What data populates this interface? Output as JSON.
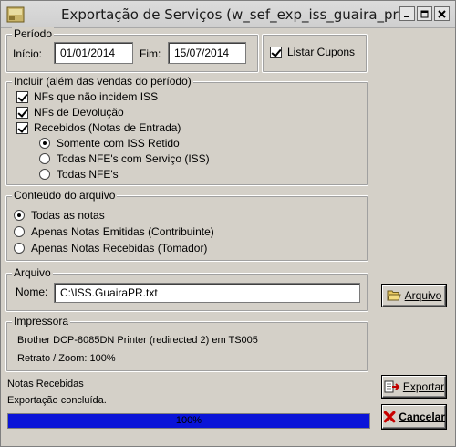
{
  "window": {
    "title": "Exportação de Serviços (w_sef_exp_iss_guaira_pr)"
  },
  "periodo": {
    "legend": "Período",
    "inicio_label": "Início:",
    "inicio_value": "01/01/2014",
    "fim_label": "Fim:",
    "fim_value": "15/07/2014"
  },
  "listar_cupons": {
    "label": "Listar Cupons",
    "checked": true
  },
  "incluir": {
    "legend": "Incluir (além das vendas do período)",
    "options": [
      {
        "label": "NFs que não incidem ISS",
        "checked": true
      },
      {
        "label": "NFs de Devolução",
        "checked": true
      },
      {
        "label": "Recebidos (Notas de Entrada)",
        "checked": true
      }
    ],
    "recebidos_options": [
      {
        "label": "Somente com ISS Retido",
        "selected": true
      },
      {
        "label": "Todas NFE's com Serviço (ISS)",
        "selected": false
      },
      {
        "label": "Todas NFE's",
        "selected": false
      }
    ]
  },
  "conteudo": {
    "legend": "Conteúdo do arquivo",
    "options": [
      {
        "label": "Todas as notas",
        "selected": true
      },
      {
        "label": "Apenas Notas Emitidas (Contribuinte)",
        "selected": false
      },
      {
        "label": "Apenas Notas Recebidas (Tomador)",
        "selected": false
      }
    ]
  },
  "arquivo": {
    "legend": "Arquivo",
    "nome_label": "Nome:",
    "nome_value": "C:\\ISS.GuairaPR.txt",
    "button_label": "Arquivo"
  },
  "impressora": {
    "legend": "Impressora",
    "printer": "Brother DCP-8085DN Printer (redirected 2) em TS005",
    "mode": "Retrato / Zoom: 100%"
  },
  "status": {
    "line1": "Notas Recebidas",
    "line2": "Exportação concluída.",
    "progress_text": "100%",
    "progress_fraction": 1.0
  },
  "buttons": {
    "exportar": "Exportar",
    "cancelar": "Cancelar"
  },
  "colors": {
    "progress": "#0a14d8",
    "window_bg": "#d4d0c8"
  }
}
